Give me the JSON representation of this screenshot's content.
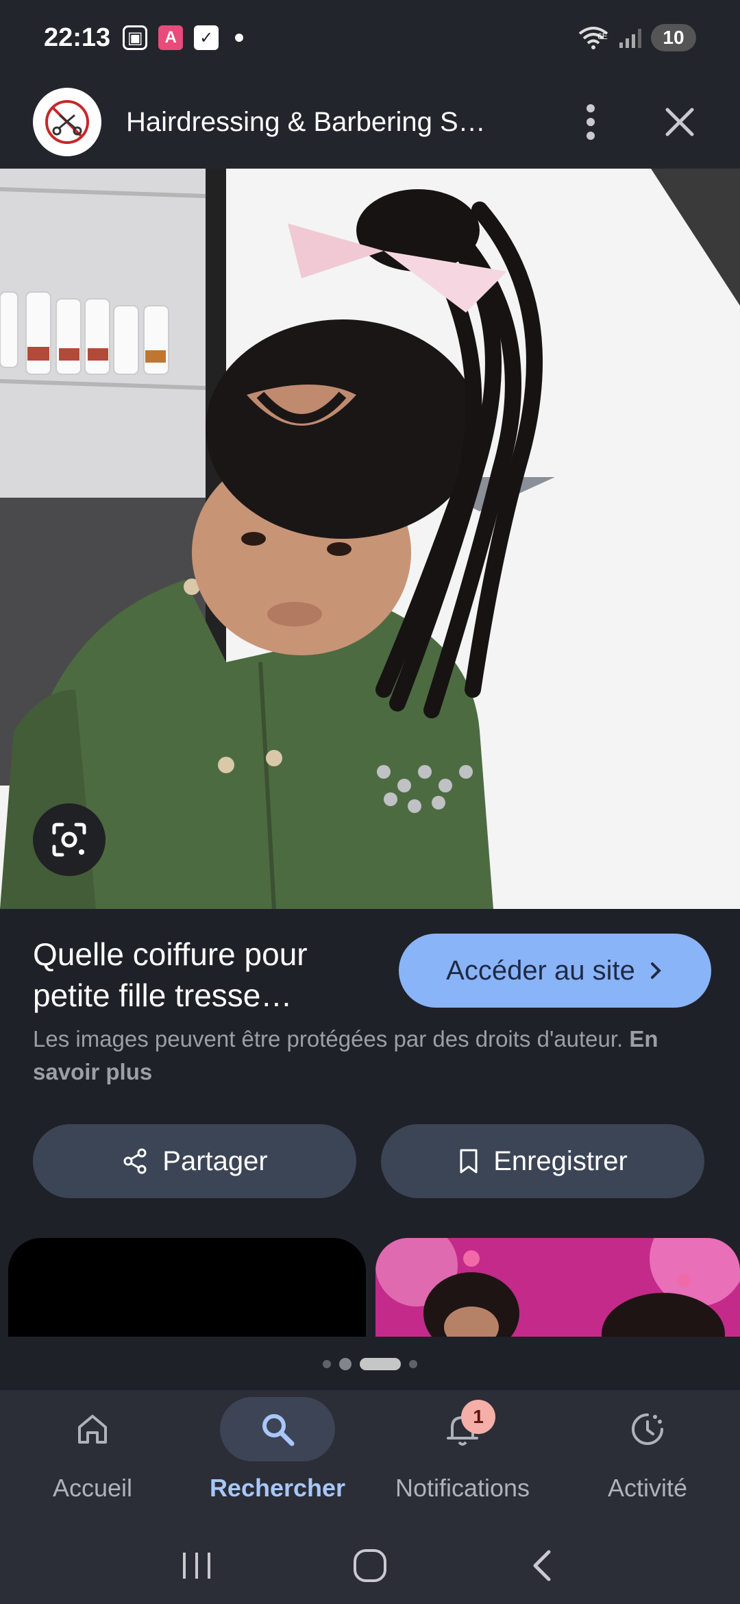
{
  "status_bar": {
    "time": "22:13",
    "battery": "10",
    "network": "6E",
    "icons": [
      "screenshot-icon",
      "app-notification-icon",
      "checkbox-icon",
      "dot-icon",
      "wifi-icon",
      "signal-icon",
      "battery-icon"
    ]
  },
  "app_bar": {
    "site_title": "Hairdressing & Barbering S…",
    "icons": [
      "site-logo-icon",
      "more-vert-icon",
      "close-icon"
    ]
  },
  "image_viewer": {
    "lens_icon": "google-lens-icon"
  },
  "result": {
    "title": "Quelle coiffure pour petite fille tresse…",
    "visit_button": "Accéder au site",
    "copyright_text": "Les images peuvent être protégées par des droits d'auteur.",
    "learn_more": "En savoir plus"
  },
  "actions": {
    "share": "Partager",
    "save": "Enregistrer"
  },
  "bottom_nav": {
    "items": [
      {
        "label": "Accueil",
        "icon": "home-icon",
        "active": false
      },
      {
        "label": "Rechercher",
        "icon": "search-icon",
        "active": true
      },
      {
        "label": "Notifications",
        "icon": "bell-icon",
        "active": false,
        "badge": "1"
      },
      {
        "label": "Activité",
        "icon": "activity-icon",
        "active": false
      }
    ]
  },
  "colors": {
    "background": "#1f2128",
    "accent": "#8ab4f8",
    "button": "#3c4556",
    "nav_active": "#a8c7fa"
  }
}
